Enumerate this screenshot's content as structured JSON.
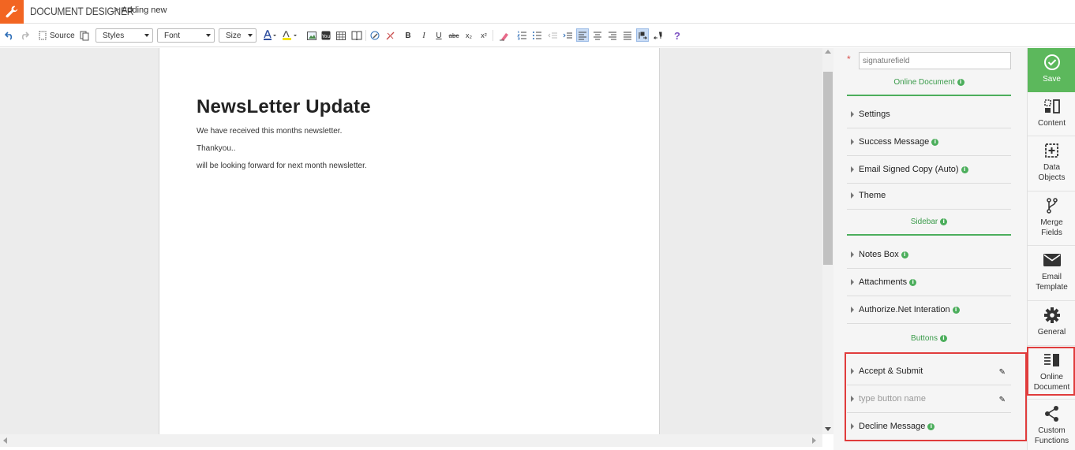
{
  "app": {
    "title": "DOCUMENT DESIGNER",
    "breadcrumb_sep": ">",
    "breadcrumb": "Adding new"
  },
  "toolbar": {
    "source_label": "Source",
    "styles_label": "Styles",
    "font_label": "Font",
    "size_label": "Size",
    "bold": "B",
    "italic": "I",
    "underline": "U",
    "strike": "abc",
    "subscript": "x₂",
    "superscript": "x²",
    "help": "?"
  },
  "editor": {
    "heading": "NewsLetter Update",
    "lines": [
      "We have received this months newsletter.",
      "Thankyou..",
      "will be looking forward for next month newsletter."
    ]
  },
  "panel": {
    "required_mark": "*",
    "field_name_value": "signaturefield",
    "sections": {
      "online_document": "Online Document",
      "sidebar": "Sidebar",
      "buttons": "Buttons"
    },
    "online_items": [
      "Settings",
      "Success Message",
      "Email Signed Copy (Auto)",
      "Theme"
    ],
    "sidebar_items": [
      "Notes Box",
      "Attachments",
      "Authorize.Net Interation"
    ],
    "buttons": {
      "accept": "Accept & Submit",
      "placeholder": "type button name",
      "decline": "Decline Message"
    }
  },
  "rail": {
    "save": "Save",
    "content": "Content",
    "data_objects_1": "Data",
    "data_objects_2": "Objects",
    "merge_fields_1": "Merge",
    "merge_fields_2": "Fields",
    "email_template_1": "Email",
    "email_template_2": "Template",
    "general": "General",
    "online_document_1": "Online",
    "online_document_2": "Document",
    "custom_functions_1": "Custom",
    "custom_functions_2": "Functions"
  },
  "colors": {
    "brand_orange": "#f26522",
    "accent_green": "#5cb85c",
    "highlight_red": "#e03c3c"
  }
}
